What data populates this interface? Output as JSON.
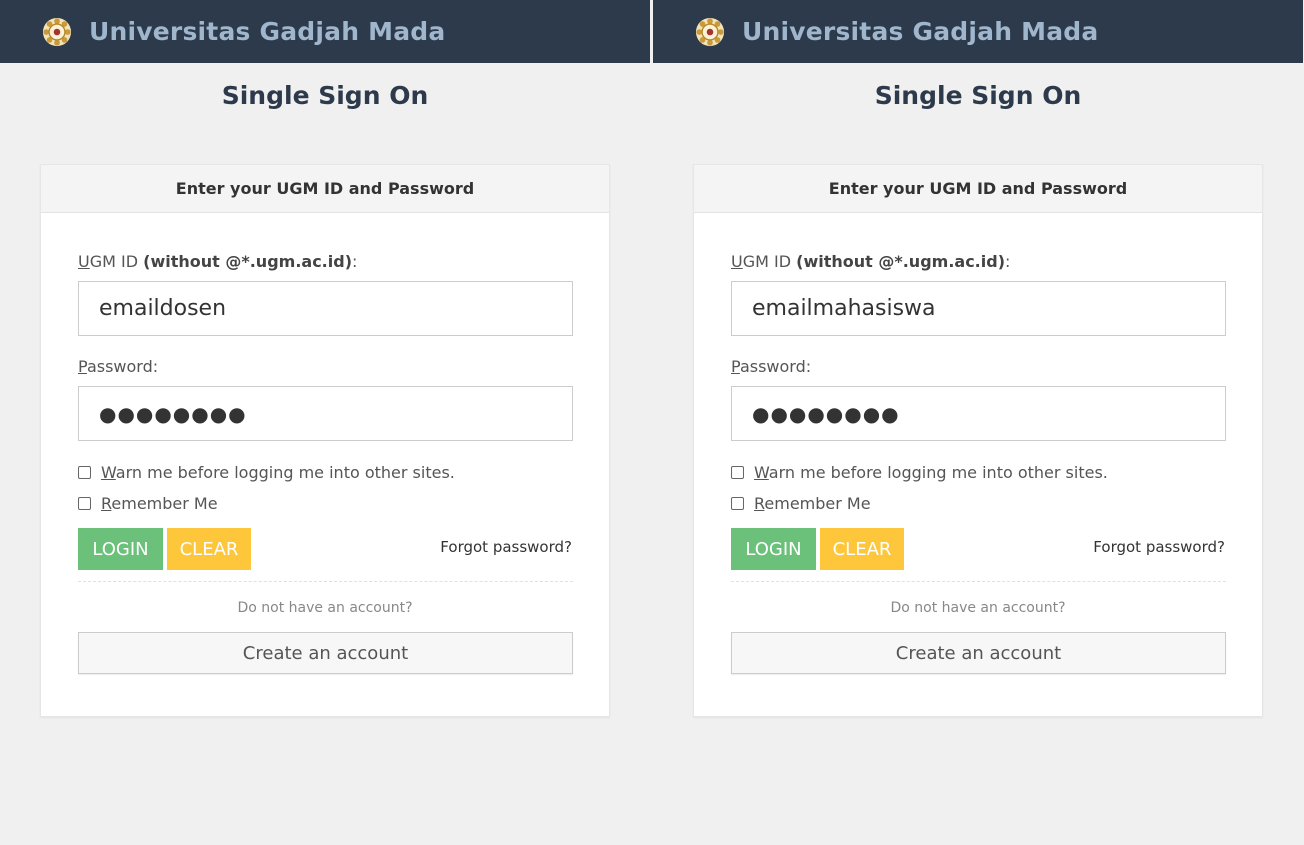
{
  "panels": [
    {
      "brand": "Universitas Gadjah Mada",
      "title": "Single Sign On",
      "card_header": "Enter your UGM ID and Password",
      "id_label_u": "U",
      "id_label_rest": "GM ID ",
      "id_label_bold": "(without @*.ugm.ac.id)",
      "id_label_colon": ":",
      "id_value": "emaildosen",
      "pw_label_u": "P",
      "pw_label_rest": "assword:",
      "pw_value": "●●●●●●●●",
      "warn_u": "W",
      "warn_rest": "arn me before logging me into other sites.",
      "remember_u": "R",
      "remember_rest": "emember Me",
      "login": "LOGIN",
      "clear": "CLEAR",
      "forgot": "Forgot password?",
      "no_account": "Do not have an account?",
      "create": "Create an account"
    },
    {
      "brand": "Universitas Gadjah Mada",
      "title": "Single Sign On",
      "card_header": "Enter your UGM ID and Password",
      "id_label_u": "U",
      "id_label_rest": "GM ID ",
      "id_label_bold": "(without @*.ugm.ac.id)",
      "id_label_colon": ":",
      "id_value": "emailmahasiswa",
      "pw_label_u": "P",
      "pw_label_rest": "assword:",
      "pw_value": "●●●●●●●●",
      "warn_u": "W",
      "warn_rest": "arn me before logging me into other sites.",
      "remember_u": "R",
      "remember_rest": "emember Me",
      "login": "LOGIN",
      "clear": "CLEAR",
      "forgot": "Forgot password?",
      "no_account": "Do not have an account?",
      "create": "Create an account"
    }
  ],
  "colors": {
    "topbar": "#2d3a4b",
    "brand_text": "#9fb6cc",
    "login_button": "#6bc07a",
    "clear_button": "#fec73b"
  },
  "icons": {
    "logo": "ugm-emblem-icon"
  }
}
